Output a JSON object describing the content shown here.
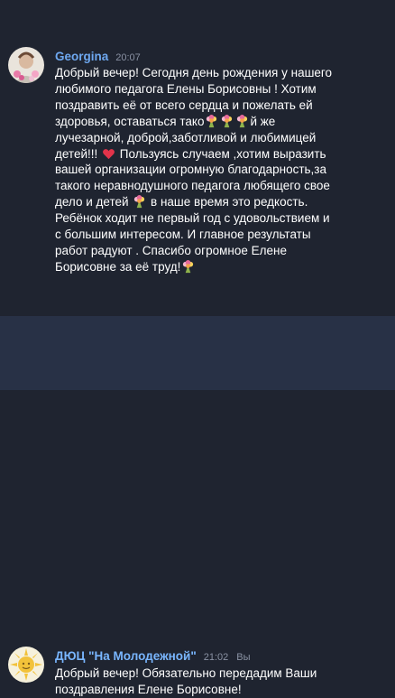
{
  "messages": [
    {
      "sender": "Georgina",
      "time": "20:07",
      "avatar_icon": "avatar-with-flowers-icon",
      "lines": [
        "Добрый вечер! Сегодня день рождения у нашего",
        "любимого педагога Елены Борисовны ! Хотим",
        "поздравить её от всего сердца и пожелать ей",
        [
          "здоровья, оставаться тако",
          "й же"
        ],
        "лучезарной, доброй,заботливой и любимицей",
        [
          "детей!!! ",
          " Пользуясь случаем ,хотим выразить"
        ],
        "вашей организации огромную благодарность,за",
        "такого неравнодушного педагога любящего свое",
        [
          "дело и детей ",
          " в наше время это редкость."
        ],
        "Ребёнок ходит не первый год с удовольствием и",
        "с большим интересом. И главное результаты",
        "работ радуют . Спасибо огромное Елене",
        "Борисовне за её труд!"
      ],
      "emojis": [
        "bouquet-icon",
        "bouquet-icon",
        "bouquet-icon",
        "red-heart-icon",
        "bouquet-icon",
        "bouquet-icon"
      ]
    },
    {
      "sender": "ДЮЦ \"На Молодежной\"",
      "time": "21:02",
      "you_label": "Вы",
      "avatar_icon": "sun-logo-icon",
      "lines": [
        "Добрый вечер! Обязательно передадим Ваши",
        "поздравления Елене Борисовне!"
      ]
    }
  ],
  "colors": {
    "background": "#1f2430",
    "highlight_background": "#283146",
    "sender_name": "#6ea8f0",
    "timestamp": "#8a92a3",
    "text": "#ffffff"
  }
}
